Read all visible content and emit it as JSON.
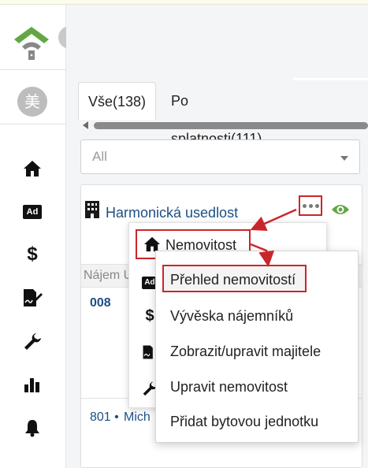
{
  "sidebar": {
    "avatar_text": "美",
    "items": [
      {
        "name": "home-icon"
      },
      {
        "name": "ad-icon",
        "label": "Ad"
      },
      {
        "name": "dollar-icon",
        "label": "$"
      },
      {
        "name": "sign-document-icon"
      },
      {
        "name": "wrench-icon"
      },
      {
        "name": "bar-chart-icon"
      },
      {
        "name": "bell-icon"
      }
    ]
  },
  "tabs": [
    {
      "label": "Vše(138)"
    },
    {
      "label": "Po splatnosti(111)"
    }
  ],
  "filter": {
    "selected": "All"
  },
  "property": {
    "name": "Harmonická usedlost"
  },
  "table": {
    "header": "Nájem U",
    "rows": [
      {
        "unit": "008"
      },
      {
        "unit": "801 •",
        "tenant": "Mich"
      }
    ]
  },
  "menu": {
    "main_item": "Nemovitost",
    "hidden_icons": [
      "Ad",
      "$"
    ],
    "submenu": [
      "Přehled nemovitostí",
      "Vývěska nájemníků",
      "Zobrazit/upravit majitele",
      "Upravit nemovitost",
      "Přidat bytovou jednotku"
    ]
  },
  "colors": {
    "accent_green": "#62a744",
    "link_blue": "#1d4f86",
    "highlight_red": "#c9262b"
  }
}
